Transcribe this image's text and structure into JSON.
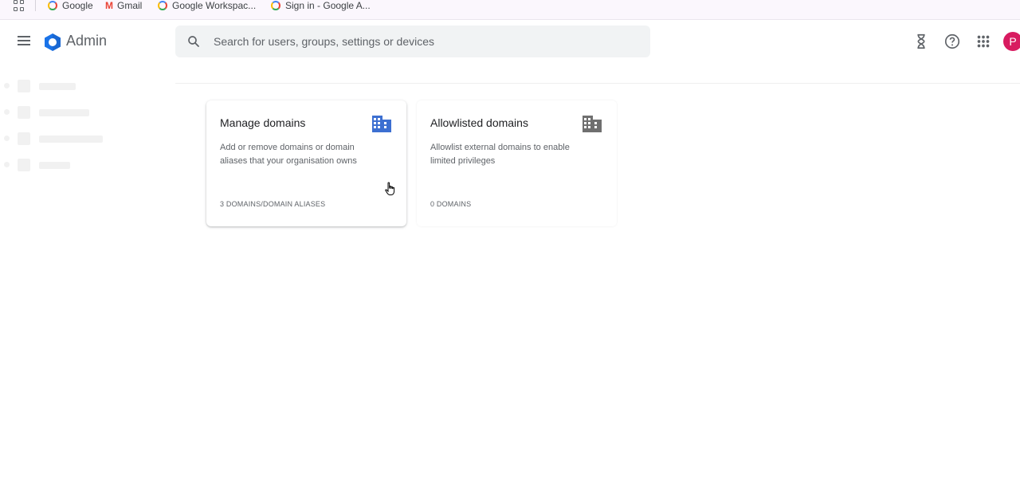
{
  "bookmarks": [
    {
      "label": "Google",
      "icon": "google-icon"
    },
    {
      "label": "Gmail",
      "icon": "gmail-icon"
    },
    {
      "label": "Google Workspac...",
      "icon": "google-icon"
    },
    {
      "label": "Sign in - Google A...",
      "icon": "google-icon"
    }
  ],
  "header": {
    "app_title": "Admin",
    "search_placeholder": "Search for users, groups, settings or devices",
    "avatar_letter": "P"
  },
  "cards": [
    {
      "title": "Manage domains",
      "description": "Add or remove domains or domain aliases that your organisation owns",
      "count": "3 DOMAINS/DOMAIN ALIASES",
      "icon": "building-icon",
      "icon_color": "#3c6fd1"
    },
    {
      "title": "Allowlisted domains",
      "description": "Allowlist external domains to enable limited privileges",
      "count": "0 DOMAINS",
      "icon": "building-icon",
      "icon_color": "#6f6f6f"
    }
  ],
  "colors": {
    "avatar": "#d81b60",
    "admin_logo": "#1a73e8"
  }
}
